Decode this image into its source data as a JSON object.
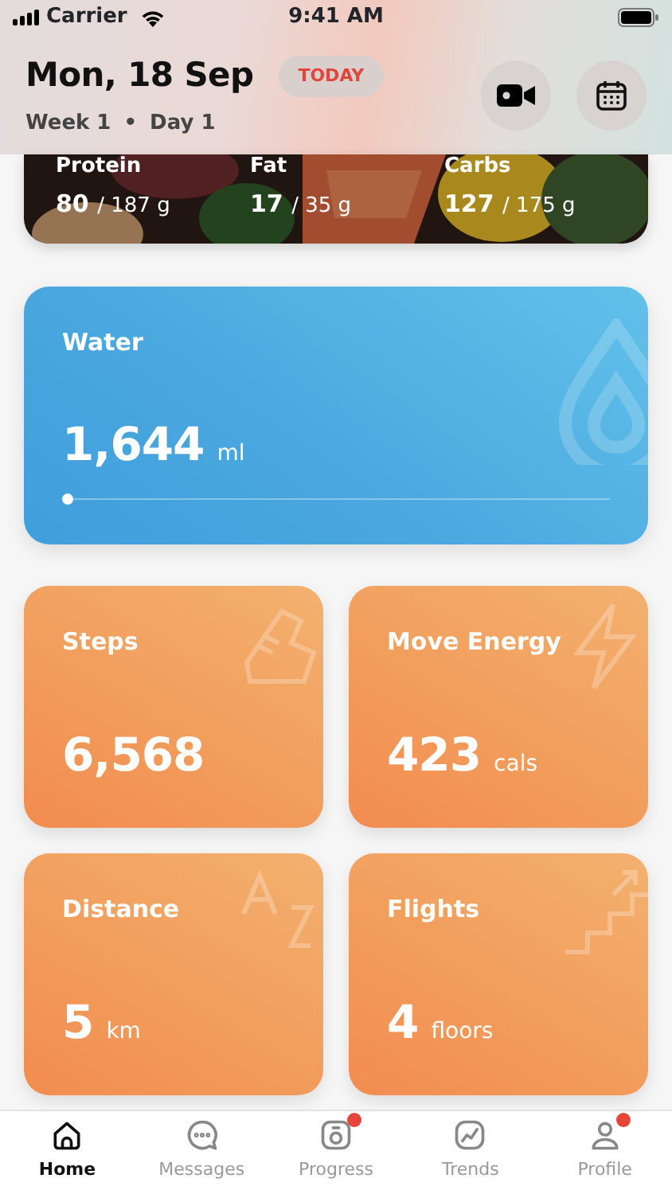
{
  "status_bar": {
    "carrier": "Carrier",
    "time": "9:41 AM"
  },
  "header": {
    "date": "Mon, 18 Sep",
    "badge": "TODAY",
    "week": "Week 1",
    "separator": "•",
    "day": "Day 1"
  },
  "macros": [
    {
      "name": "Protein",
      "amount": "80",
      "target": "/ 187 g"
    },
    {
      "name": "Fat",
      "amount": "17",
      "target": "/ 35 g"
    },
    {
      "name": "Carbs",
      "amount": "127",
      "target": "/ 175 g"
    }
  ],
  "water": {
    "title": "Water",
    "value": "1,644",
    "unit": "ml",
    "level": 0
  },
  "tiles": [
    {
      "kind": "steps",
      "title": "Steps",
      "value": "6,568"
    },
    {
      "kind": "energy",
      "title": "Move Energy",
      "value": "423",
      "unit": "cals"
    },
    {
      "kind": "distance",
      "title": "Distance",
      "value": "5",
      "unit": "km"
    },
    {
      "kind": "flights",
      "title": "Flights",
      "value": "4",
      "unit": "floors"
    }
  ],
  "tabs": [
    {
      "kind": "home",
      "label": "Home",
      "selected": true,
      "badge": false
    },
    {
      "kind": "messages",
      "label": "Messages",
      "selected": false,
      "badge": false
    },
    {
      "kind": "progress",
      "label": "Progress",
      "selected": false,
      "badge": true
    },
    {
      "kind": "trends",
      "label": "Trends",
      "selected": false,
      "badge": false
    },
    {
      "kind": "profile",
      "label": "Profile",
      "selected": false,
      "badge": true
    }
  ]
}
